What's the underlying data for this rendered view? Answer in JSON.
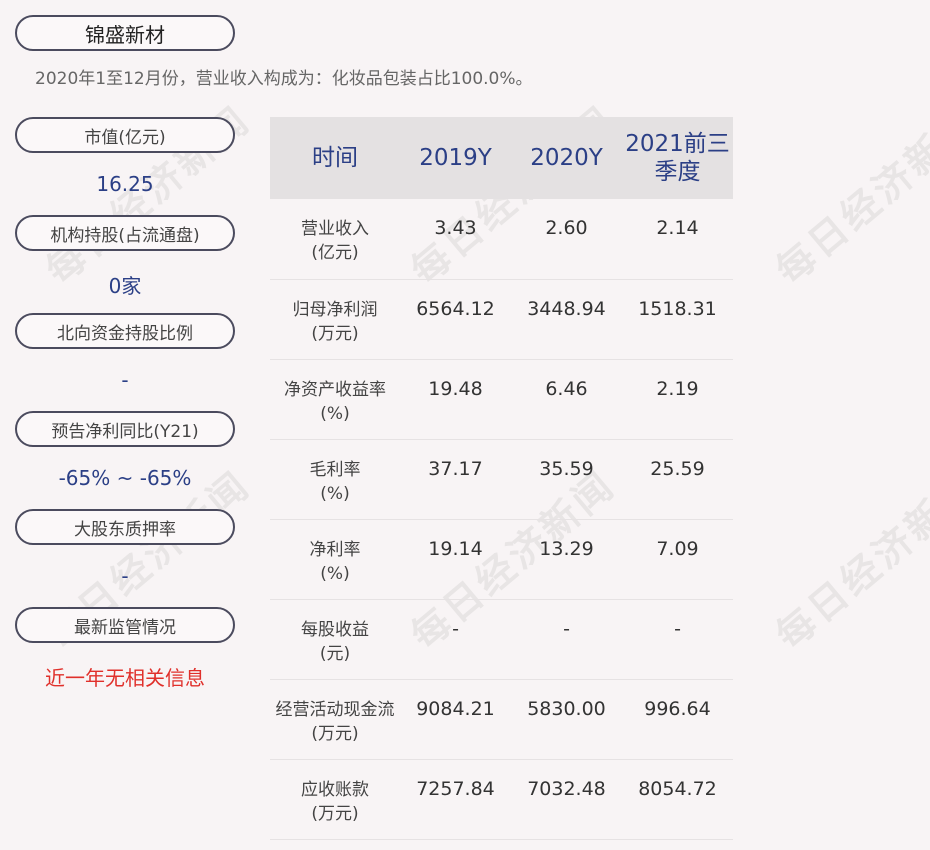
{
  "company": "锦盛新材",
  "subtitle": "2020年1至12月份，营业收入构成为：化妆品包装占比100.0%。",
  "watermark": "每日经济新闻",
  "metrics": [
    {
      "label": "市值(亿元)",
      "value": "16.25"
    },
    {
      "label": "机构持股(占流通盘)",
      "value": "0家"
    },
    {
      "label": "北向资金持股比例",
      "value": "-"
    },
    {
      "label": "预告净利同比(Y21)",
      "value": "-65% ~ -65%"
    },
    {
      "label": "大股东质押率",
      "value": "-"
    },
    {
      "label": "最新监管情况",
      "value": "近一年无相关信息"
    }
  ],
  "table": {
    "headers": [
      "时间",
      "2019Y",
      "2020Y",
      "2021前三季度"
    ],
    "rows": [
      {
        "name": "营业收入",
        "unit": "(亿元)",
        "values": [
          "3.43",
          "2.60",
          "2.14"
        ]
      },
      {
        "name": "归母净利润",
        "unit": "(万元)",
        "values": [
          "6564.12",
          "3448.94",
          "1518.31"
        ]
      },
      {
        "name": "净资产收益率",
        "unit": "(%)",
        "values": [
          "19.48",
          "6.46",
          "2.19"
        ]
      },
      {
        "name": "毛利率",
        "unit": "(%)",
        "values": [
          "37.17",
          "35.59",
          "25.59"
        ]
      },
      {
        "name": "净利率",
        "unit": "(%)",
        "values": [
          "19.14",
          "13.29",
          "7.09"
        ]
      },
      {
        "name": "每股收益",
        "unit": "(元)",
        "values": [
          "-",
          "-",
          "-"
        ]
      },
      {
        "name": "经营活动现金流",
        "unit": "(万元)",
        "values": [
          "9084.21",
          "5830.00",
          "996.64"
        ]
      },
      {
        "name": "应收账款",
        "unit": "(万元)",
        "values": [
          "7257.84",
          "7032.48",
          "8054.72"
        ]
      }
    ]
  }
}
